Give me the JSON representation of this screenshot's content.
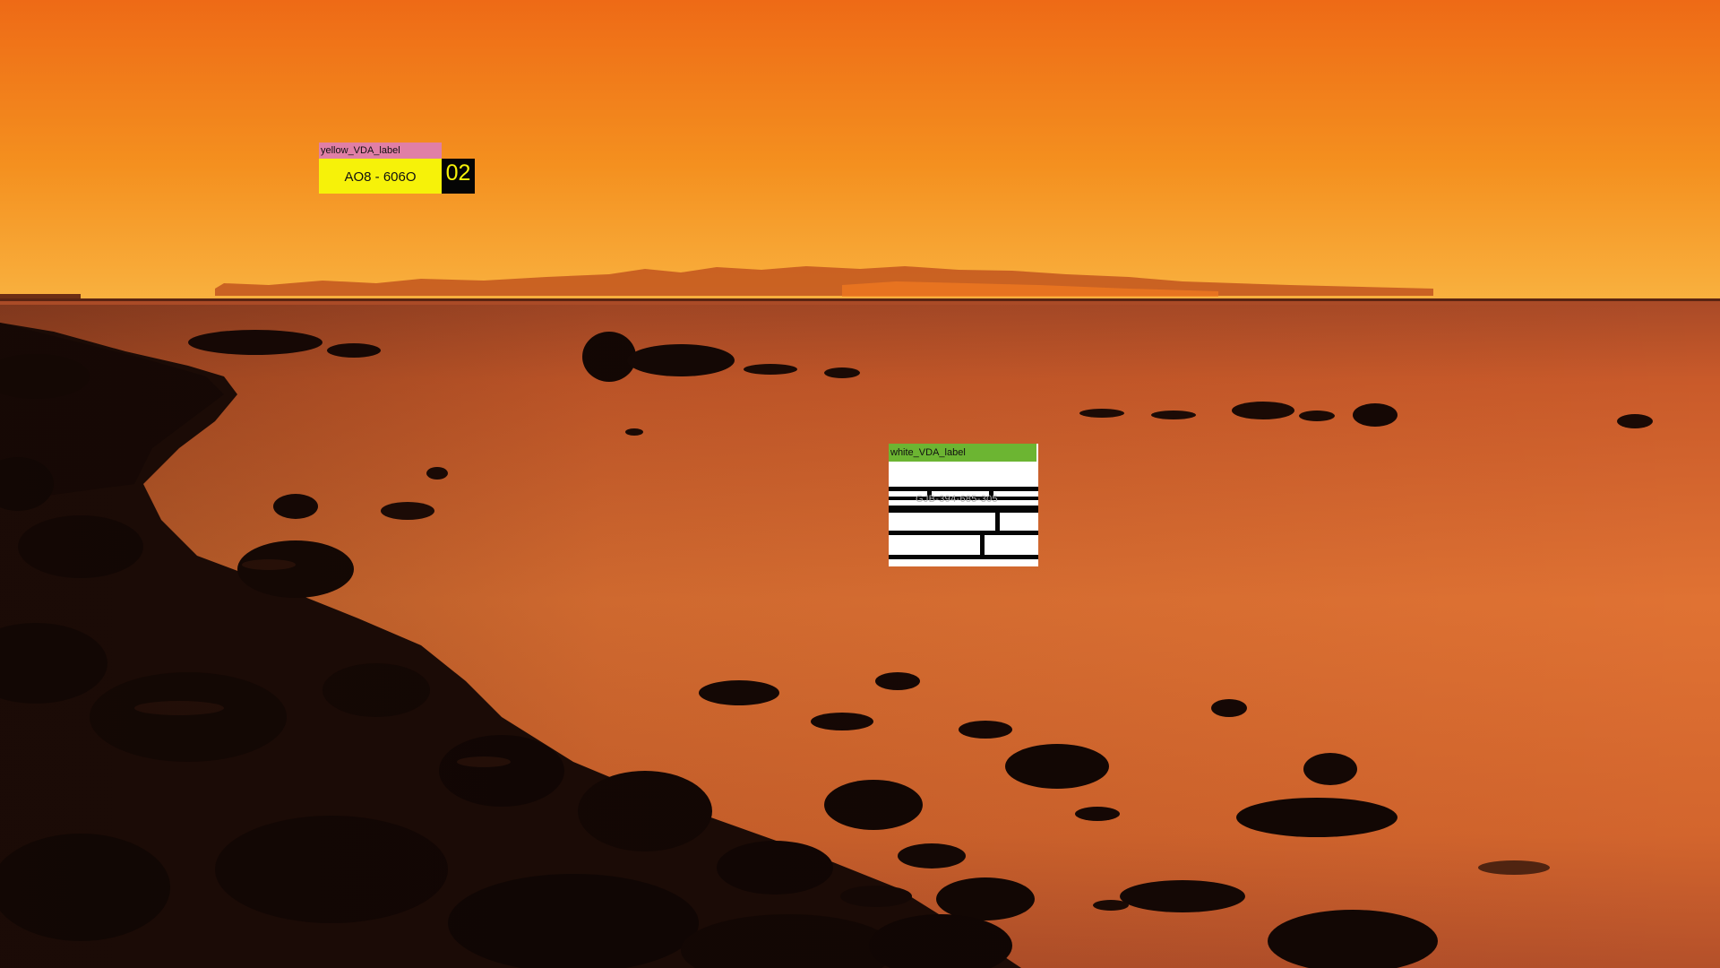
{
  "labels": {
    "yellow": {
      "title": "yellow_VDA_label",
      "code": "AO8 - 606O",
      "badge": "02"
    },
    "white": {
      "title": "white_VDA_label",
      "code": "GJB-394-685-305"
    }
  },
  "colors": {
    "sky_top": "#f0771c",
    "sky_glow": "#f8ae3c",
    "sea": "#d86a2e",
    "rocks": "#120805",
    "yellow_title_bg": "#e07fa6",
    "yellow_body_bg": "#f6f209",
    "badge_bg": "#050505",
    "white_title_bg": "#6cb532"
  }
}
